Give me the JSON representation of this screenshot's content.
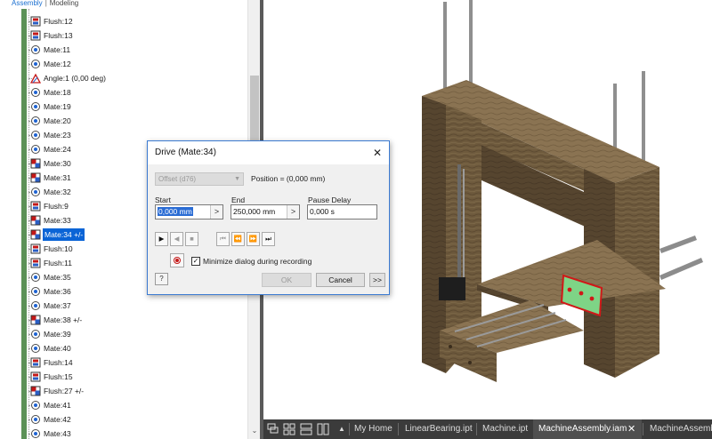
{
  "browser": {
    "tab_assembly": "Assembly",
    "tab_separator": "|",
    "tab_modeling": "Modeling",
    "items": [
      {
        "label": "Flush:12",
        "icon": "flush-icon"
      },
      {
        "label": "Flush:13",
        "icon": "flush-icon"
      },
      {
        "label": "Mate:11",
        "icon": "mate-icon"
      },
      {
        "label": "Mate:12",
        "icon": "mate-icon"
      },
      {
        "label": "Angle:1 (0,00 deg)",
        "icon": "angle-icon"
      },
      {
        "label": "Mate:18",
        "icon": "mate-icon"
      },
      {
        "label": "Mate:19",
        "icon": "mate-icon"
      },
      {
        "label": "Mate:20",
        "icon": "mate-icon"
      },
      {
        "label": "Mate:23",
        "icon": "mate-icon"
      },
      {
        "label": "Mate:24",
        "icon": "mate-icon"
      },
      {
        "label": "Mate:30",
        "icon": "mate-red-icon"
      },
      {
        "label": "Mate:31",
        "icon": "mate-red-icon"
      },
      {
        "label": "Mate:32",
        "icon": "mate-icon"
      },
      {
        "label": "Flush:9",
        "icon": "flush-icon"
      },
      {
        "label": "Mate:33",
        "icon": "mate-red-icon"
      },
      {
        "label": "Mate:34 +/-",
        "icon": "mate-red-icon",
        "selected": true
      },
      {
        "label": "Flush:10",
        "icon": "flush-icon"
      },
      {
        "label": "Flush:11",
        "icon": "flush-icon"
      },
      {
        "label": "Mate:35",
        "icon": "mate-icon"
      },
      {
        "label": "Mate:36",
        "icon": "mate-icon"
      },
      {
        "label": "Mate:37",
        "icon": "mate-icon"
      },
      {
        "label": "Mate:38 +/-",
        "icon": "mate-red-icon"
      },
      {
        "label": "Mate:39",
        "icon": "mate-icon"
      },
      {
        "label": "Mate:40",
        "icon": "mate-icon"
      },
      {
        "label": "Flush:14",
        "icon": "flush-icon"
      },
      {
        "label": "Flush:15",
        "icon": "flush-icon"
      },
      {
        "label": "Flush:27 +/-",
        "icon": "mate-red-icon"
      },
      {
        "label": "Mate:41",
        "icon": "mate-icon"
      },
      {
        "label": "Mate:42",
        "icon": "mate-icon"
      },
      {
        "label": "Mate:43",
        "icon": "mate-icon"
      }
    ]
  },
  "dialog": {
    "title": "Drive (Mate:34)",
    "close_glyph": "✕",
    "offset_select": "Offset (d76)",
    "position_text": "Position = (0,000 mm)",
    "start_label": "Start",
    "start_value": "0,000 mm",
    "end_label": "End",
    "end_value": "250,000 mm",
    "pause_label": "Pause Delay",
    "pause_value": "0,000 s",
    "field_arrow": ">",
    "minimize_label": "Minimize dialog during recording",
    "minimize_checked": "✓",
    "help_glyph": "?",
    "ok_label": "OK",
    "cancel_label": "Cancel",
    "more_label": ">>",
    "controls": {
      "forward": "▶",
      "reverse": "◀",
      "stop": "■",
      "goto_start": "⏮",
      "step_reverse": "⏪",
      "step_forward": "⏩",
      "goto_end": "⏭"
    }
  },
  "doc_tabs": {
    "items": [
      {
        "label": "My Home"
      },
      {
        "label": "LinearBearing.ipt"
      },
      {
        "label": "Machine.ipt"
      },
      {
        "label": "MachineAssembly.iam",
        "active": true
      },
      {
        "label": "MachineAssemb"
      }
    ],
    "close_glyph": "✕",
    "up_glyph": "▲"
  },
  "colors": {
    "accent": "#1a6fd0",
    "selection": "#0a64d6",
    "wood_dark": "#5e4b33",
    "wood_mid": "#7d6647",
    "wood_light": "#9a8361",
    "green_plate": "#7ed486",
    "red_outline": "#d01818"
  }
}
